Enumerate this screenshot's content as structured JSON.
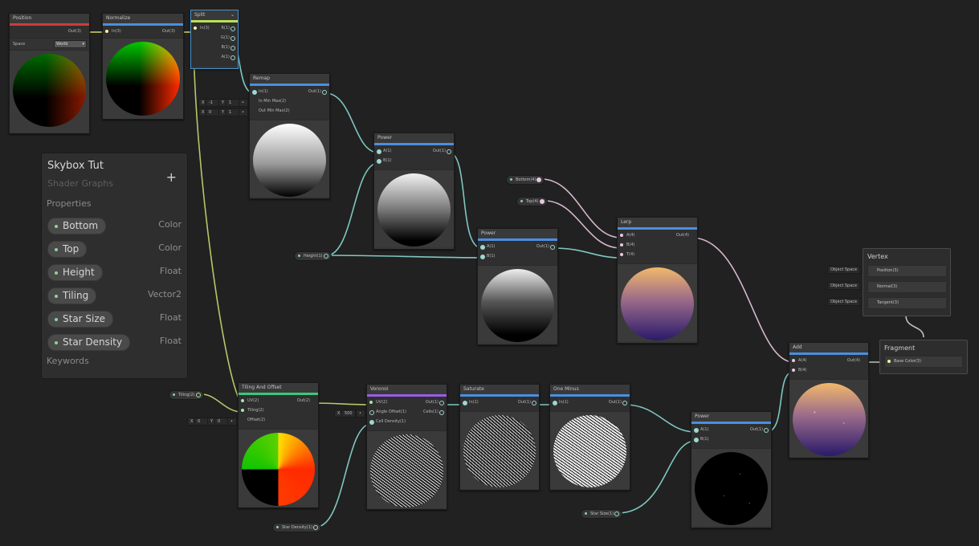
{
  "colors": {
    "background": "#212121",
    "position_bar": "#d13a3a",
    "vector_bar": "#4a8fe0",
    "split_bar": "#b9e05a",
    "uv_bar": "#3ac87a",
    "voronoi_bar": "#9a5ce8",
    "wire_float": "#7fc7c2",
    "wire_vector": "#d6d46a",
    "wire_color": "#d7b8cf"
  },
  "blackboard": {
    "title": "Skybox Tut",
    "subtitle": "Shader Graphs",
    "add_icon": "+",
    "properties_label": "Properties",
    "keywords_label": "Keywords",
    "properties": [
      {
        "name": "Bottom",
        "type": "Color"
      },
      {
        "name": "Top",
        "type": "Color"
      },
      {
        "name": "Height",
        "type": "Float"
      },
      {
        "name": "Tiling",
        "type": "Vector2"
      },
      {
        "name": "Star Size",
        "type": "Float"
      },
      {
        "name": "Star Density",
        "type": "Float"
      }
    ]
  },
  "nodes": {
    "position": {
      "title": "Position",
      "out": "Out(3)",
      "space_label": "Space",
      "space_value": "World",
      "dropdown_icon": "▾"
    },
    "normalize": {
      "title": "Normalize",
      "in": "In(3)",
      "out": "Out(3)"
    },
    "split": {
      "title": "Split",
      "in": "In(3)",
      "outs": [
        "R(1)",
        "G(1)",
        "B(1)",
        "A(1)"
      ],
      "collapse_icon": "⌄"
    },
    "remap": {
      "title": "Remap",
      "ins": [
        "In(1)",
        "In Min Max(2)",
        "Out Min Max(2)"
      ],
      "out": "Out(1)",
      "in_min_max": {
        "x": "-1",
        "y": "1"
      },
      "out_min_max": {
        "x": "0",
        "y": "1"
      }
    },
    "power1": {
      "title": "Power",
      "ins": [
        "A(1)",
        "B(1)"
      ],
      "out": "Out(1)"
    },
    "power2": {
      "title": "Power",
      "ins": [
        "A(1)",
        "B(1)"
      ],
      "out": "Out(1)"
    },
    "lerp": {
      "title": "Lerp",
      "ins": [
        "A(4)",
        "B(4)",
        "T(4)"
      ],
      "out": "Out(4)"
    },
    "add": {
      "title": "Add",
      "ins": [
        "A(4)",
        "B(4)"
      ],
      "out": "Out(4)"
    },
    "tiling": {
      "title": "Tiling And Offset",
      "ins": [
        "UV(2)",
        "Tiling(2)",
        "Offset(2)"
      ],
      "out": "Out(2)",
      "offset": {
        "x": "0",
        "y": "0"
      }
    },
    "voronoi": {
      "title": "Voronoi",
      "ins": [
        "UV(2)",
        "Angle Offset(1)",
        "Cell Density(1)"
      ],
      "outs": [
        "Out(1)",
        "Cells(1)"
      ],
      "angle_offset": "500"
    },
    "saturate": {
      "title": "Saturate",
      "in": "In(1)",
      "out": "Out(1)"
    },
    "oneminus": {
      "title": "One Minus",
      "in": "In(1)",
      "out": "Out(1)"
    },
    "power3": {
      "title": "Power",
      "ins": [
        "A(1)",
        "B(1)"
      ],
      "out": "Out(1)"
    }
  },
  "property_nodes": {
    "bottom": "Bottom(4)",
    "top": "Top(4)",
    "height": "Height(1)",
    "tiling": "Tiling(2)",
    "star_density": "Star Density(1)",
    "star_size": "Star Size(1)"
  },
  "master": {
    "vertex": {
      "title": "Vertex",
      "slots": [
        {
          "space": "Object Space",
          "label": "Position(3)"
        },
        {
          "space": "Object Space",
          "label": "Normal(3)"
        },
        {
          "space": "Object Space",
          "label": "Tangent(3)"
        }
      ]
    },
    "fragment": {
      "title": "Fragment",
      "slots": [
        {
          "label": "Base Color(3)"
        }
      ]
    }
  },
  "axis_labels": {
    "x": "X",
    "y": "Y"
  }
}
